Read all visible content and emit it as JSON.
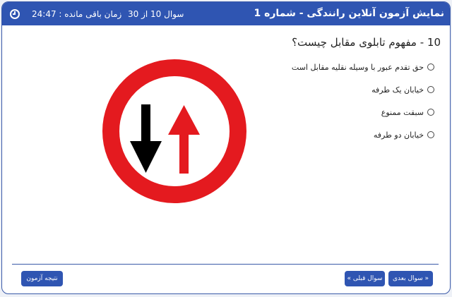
{
  "header": {
    "title": "نمایش آزمون آنلاین رانندگی - شماره 1",
    "counter": "سوال 10 از 30",
    "timer": "زمان باقی مانده : 24:47"
  },
  "question": {
    "text": "10 - مفهوم تابلوی مقابل چیست؟",
    "options": [
      "حق تقدم عبور با وسیله نقلیه مقابل است",
      "خیابان یک طرفه",
      "سبقت ممنوع",
      "خیابان دو طرفه"
    ]
  },
  "sign": {
    "icon": "priority-to-oncoming-traffic-sign",
    "ring_color": "#e41a1f",
    "down_arrow_color": "#000000",
    "up_arrow_color": "#e41a1f"
  },
  "footer": {
    "next_label": "« سوال بعدی",
    "prev_label": "سوال قبلی »",
    "result_label": "نتیجه آزمون"
  },
  "colors": {
    "accent": "#2f55b2"
  }
}
